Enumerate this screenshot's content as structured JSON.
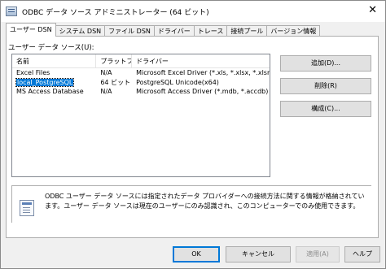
{
  "window": {
    "title": "ODBC データ ソース アドミニストレーター (64 ビット)",
    "close_glyph": "✕"
  },
  "tabs": [
    {
      "label": "ユーザー DSN",
      "active": true
    },
    {
      "label": "システム DSN",
      "active": false
    },
    {
      "label": "ファイル DSN",
      "active": false
    },
    {
      "label": "ドライバー",
      "active": false
    },
    {
      "label": "トレース",
      "active": false
    },
    {
      "label": "接続プール",
      "active": false
    },
    {
      "label": "バージョン情報",
      "active": false
    }
  ],
  "user_dsn": {
    "section_label": "ユーザー データ ソース(U):",
    "columns": [
      "名前",
      "プラットフォーム",
      "ドライバー"
    ],
    "rows": [
      {
        "name": "Excel Files",
        "platform": "N/A",
        "driver": "Microsoft Excel Driver (*.xls, *.xlsx, *.xlsm, *.xlsb)"
      },
      {
        "name": "local_PostgreSQL",
        "platform": "64 ビット",
        "driver": "PostgreSQL Unicode(x64)",
        "selected": true
      },
      {
        "name": "MS Access Database",
        "platform": "N/A",
        "driver": "Microsoft Access Driver (*.mdb, *.accdb)"
      }
    ],
    "buttons": {
      "add": "追加(D)...",
      "remove": "削除(R)",
      "configure": "構成(C)..."
    },
    "info_text": "ODBC ユーザー データ ソースには指定されたデータ プロバイダーへの接続方法に関する情報が格納されています。ユーザー データ ソースは現在のユーザーにのみ認識され、このコンピューターでのみ使用できます。"
  },
  "footer": {
    "ok": "OK",
    "cancel": "キャンセル",
    "apply": "適用(A)",
    "help": "ヘルプ"
  }
}
